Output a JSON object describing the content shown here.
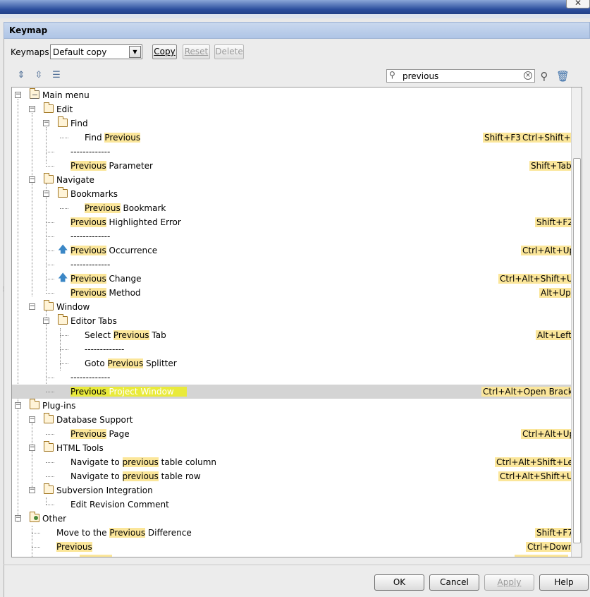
{
  "window": {
    "close_glyph": "✕",
    "title": "Keymap"
  },
  "toolbar": {
    "keymaps_label": "Keymaps:",
    "keymap_selected": "Default copy",
    "copy_label": "Copy",
    "reset_label": "Reset",
    "delete_label": "Delete"
  },
  "search": {
    "value": "previous"
  },
  "tree": {
    "main_menu": "Main menu",
    "edit": "Edit",
    "find": "Find",
    "find_prev_pre": "Find ",
    "find_prev_hl": "Previous",
    "find_prev_sc1": "Shift+F3",
    "find_prev_sc2": "Ctrl+Shift+L",
    "sep1": "-------------",
    "prev_param_hl": "Previous",
    "prev_param_post": " Parameter",
    "prev_param_sc": "Shift+Tab",
    "navigate": "Navigate",
    "bookmarks": "Bookmarks",
    "prev_bookmark_hl": "Previous",
    "prev_bookmark_post": " Bookmark",
    "prev_hl_err_hl": "Previous",
    "prev_hl_err_post": " Highlighted Error",
    "prev_hl_err_sc": "Shift+F2",
    "sep2": "-------------",
    "prev_occ_hl": "Previous",
    "prev_occ_post": " Occurrence",
    "prev_occ_sc": "Ctrl+Alt+Up",
    "sep3": "-------------",
    "prev_change_hl": "Previous",
    "prev_change_post": " Change",
    "prev_change_sc": "Ctrl+Alt+Shift+Up",
    "prev_method_hl": "Previous",
    "prev_method_post": " Method",
    "prev_method_sc": "Alt+Up",
    "window": "Window",
    "editor_tabs": "Editor Tabs",
    "select_prev_tab_pre": "Select ",
    "select_prev_tab_hl": "Previous",
    "select_prev_tab_post": " Tab",
    "select_prev_tab_sc": "Alt+Left",
    "sep4": "-------------",
    "goto_prev_splitter_pre": "Goto ",
    "goto_prev_splitter_hl": "Previous",
    "goto_prev_splitter_post": " Splitter",
    "sep5": "-------------",
    "prev_project_window_hl": "Previous",
    "prev_project_window_post": " Project Window",
    "prev_project_window_sc": "Ctrl+Alt+Open Bracket",
    "plugins": "Plug-ins",
    "database_support": "Database Support",
    "prev_page_hl": "Previous",
    "prev_page_post": " Page",
    "prev_page_sc": "Ctrl+Alt+Up",
    "html_tools": "HTML Tools",
    "nav_prev_col_pre": "Navigate to ",
    "nav_prev_col_hl": "previous",
    "nav_prev_col_post": " table column",
    "nav_prev_col_sc": "Ctrl+Alt+Shift+Left",
    "nav_prev_row_pre": "Navigate to ",
    "nav_prev_row_hl": "previous",
    "nav_prev_row_post": " table row",
    "nav_prev_row_sc": "Ctrl+Alt+Shift+Up",
    "subversion": "Subversion Integration",
    "edit_rev_comment": "Edit Revision Comment",
    "other": "Other",
    "move_prev_diff_pre": "Move to the ",
    "move_prev_diff_hl": "Previous",
    "move_prev_diff_post": " Difference",
    "move_prev_diff_sc": "Shift+F7",
    "previous_hl": "Previous",
    "previous_sc": "Ctrl+Down"
  },
  "buttons": {
    "ok": "OK",
    "cancel": "Cancel",
    "apply": "Apply",
    "help": "Help"
  },
  "icons": {
    "expand_all": "expand-all-icon",
    "collapse_all": "collapse-all-icon",
    "edit_shortcut": "edit-shortcut-icon",
    "find_by_shortcut": "find-by-shortcut-icon",
    "clear_filter": "clear-filter-icon"
  },
  "colors": {
    "highlight": "#fbe69a",
    "selected_highlight": "#e9ea3b",
    "selected_row": "#d4d4d4",
    "title_bar": "#b9cdea"
  }
}
